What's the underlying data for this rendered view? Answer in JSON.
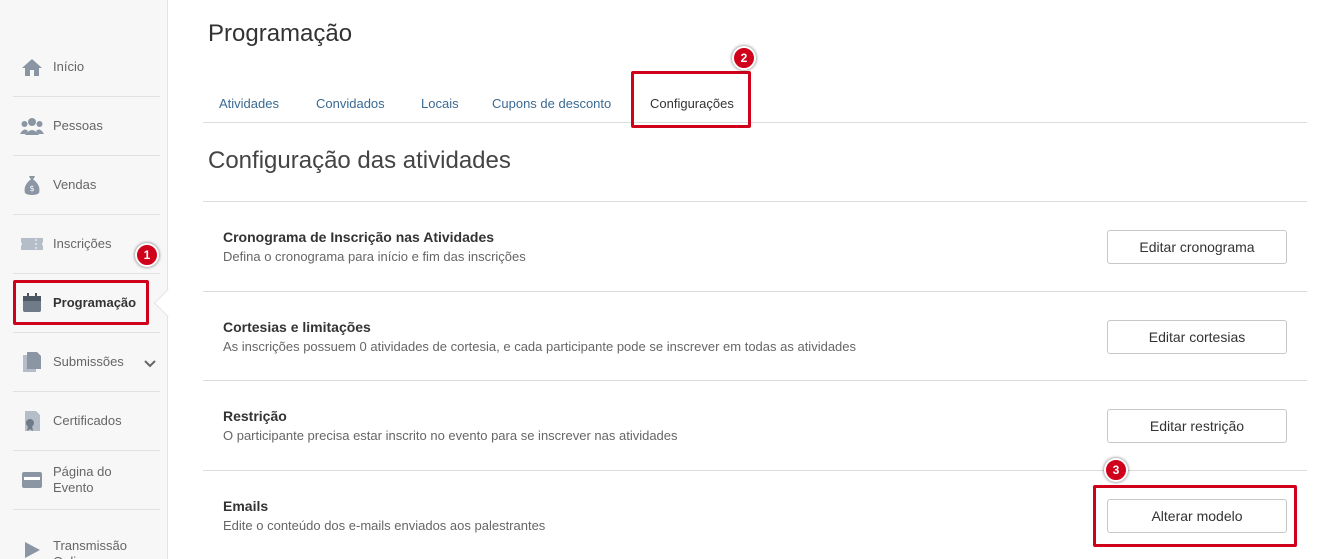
{
  "sidebar": {
    "items": [
      {
        "label": "Início",
        "icon": "home-icon"
      },
      {
        "label": "Pessoas",
        "icon": "people-icon"
      },
      {
        "label": "Vendas",
        "icon": "money-bag-icon"
      },
      {
        "label": "Inscrições",
        "icon": "ticket-icon"
      },
      {
        "label": "Programação",
        "icon": "calendar-icon",
        "active": true
      },
      {
        "label": "Submissões",
        "icon": "documents-icon"
      },
      {
        "label": "Certificados",
        "icon": "certificate-icon"
      },
      {
        "label": "Página do\nEvento",
        "icon": "webpage-icon"
      },
      {
        "label": "Transmissão\nOnline",
        "icon": "play-icon"
      }
    ]
  },
  "header": {
    "title": "Programação"
  },
  "tabs": [
    {
      "label": "Atividades"
    },
    {
      "label": "Convidados"
    },
    {
      "label": "Locais"
    },
    {
      "label": "Cupons de desconto"
    },
    {
      "label": "Configurações",
      "active": true
    }
  ],
  "section": {
    "title": "Configuração das atividades"
  },
  "settings": [
    {
      "title": "Cronograma de Inscrição nas Atividades",
      "description": "Defina o cronograma para início e fim das inscrições",
      "button": "Editar cronograma"
    },
    {
      "title": "Cortesias e limitações",
      "description": "As inscrições possuem 0 atividades de cortesia, e cada participante pode se inscrever em todas as atividades",
      "button": "Editar cortesias"
    },
    {
      "title": "Restrição",
      "description": "O participante precisa estar inscrito no evento para se inscrever nas atividades",
      "button": "Editar restrição"
    },
    {
      "title": "Emails",
      "description": "Edite o conteúdo dos e-mails enviados aos palestrantes",
      "button": "Alterar modelo"
    }
  ],
  "annotations": {
    "badge1": "1",
    "badge2": "2",
    "badge3": "3"
  },
  "colors": {
    "annotation": "#d0021b",
    "link": "#3a6a93",
    "icon": "#8a96a3"
  }
}
